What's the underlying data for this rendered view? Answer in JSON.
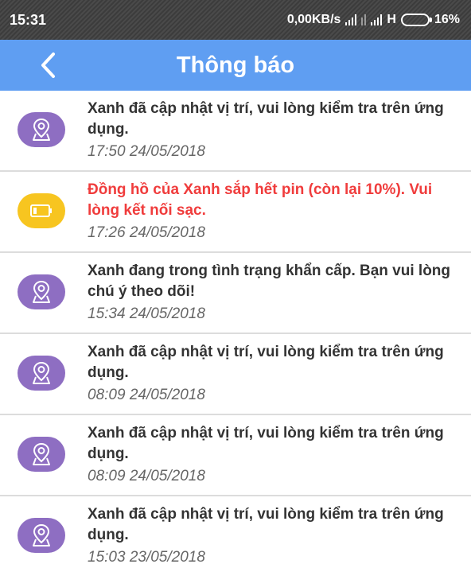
{
  "status_bar": {
    "time": "15:31",
    "net_speed": "0,00KB/s",
    "network_type": "H",
    "battery_percent": "16%"
  },
  "header": {
    "title": "Thông báo",
    "back_icon": "chevron-left-icon"
  },
  "notifications": [
    {
      "icon": "location-pin-icon",
      "message": "Xanh đã cập nhật vị trí, vui lòng kiểm tra trên ứng dụng.",
      "time": "17:50 24/05/2018",
      "alert": false
    },
    {
      "icon": "battery-low-icon",
      "message": "Đồng hồ của Xanh sắp hết pin (còn lại 10%). Vui lòng kết nối sạc.",
      "time": "17:26 24/05/2018",
      "alert": true
    },
    {
      "icon": "location-pin-icon",
      "message": "Xanh đang trong tình trạng khẩn cấp. Bạn vui lòng chú ý theo dõi!",
      "time": "15:34 24/05/2018",
      "alert": false
    },
    {
      "icon": "location-pin-icon",
      "message": "Xanh đã cập nhật vị trí, vui lòng kiểm tra trên ứng dụng.",
      "time": "08:09 24/05/2018",
      "alert": false
    },
    {
      "icon": "location-pin-icon",
      "message": "Xanh đã cập nhật vị trí, vui lòng kiểm tra trên ứng dụng.",
      "time": "08:09 24/05/2018",
      "alert": false
    },
    {
      "icon": "location-pin-icon",
      "message": "Xanh đã cập nhật vị trí, vui lòng kiểm tra trên ứng dụng.",
      "time": "15:03 23/05/2018",
      "alert": false
    }
  ],
  "colors": {
    "app_bar": "#5f9ef2",
    "location_icon_bg": "#8e6ec2",
    "battery_icon_bg": "#f7c520",
    "alert_text": "#f03c3c"
  }
}
